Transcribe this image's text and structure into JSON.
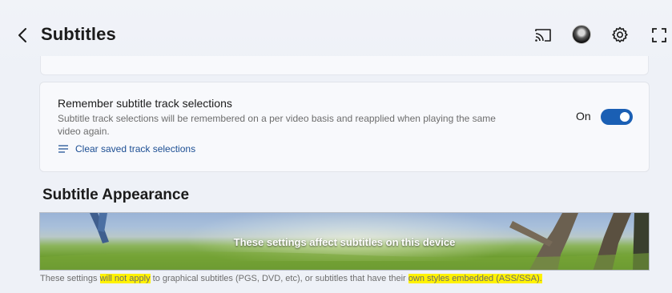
{
  "header": {
    "title": "Subtitles",
    "icons": [
      "back-arrow-icon",
      "cast-icon",
      "avatar",
      "gear-icon",
      "fullscreen-icon"
    ]
  },
  "remember_setting": {
    "title": "Remember subtitle track selections",
    "description": "Subtitle track selections will be remembered on a per video basis and reapplied when playing the same video again.",
    "clear_link": "Clear saved track selections",
    "state_label": "On",
    "enabled": true
  },
  "appearance": {
    "heading": "Subtitle Appearance",
    "banner_text": "These settings affect subtitles on this device",
    "note": {
      "part1": "These settings ",
      "highlight1": "will not apply",
      "part2": " to graphical subtitles (PGS, DVD, etc), or subtitles that have their ",
      "highlight2": "own styles embedded (ASS/SSA)."
    }
  },
  "colors": {
    "accent": "#1a5fb4",
    "link": "#1c4e93",
    "highlight": "#fff200",
    "background": "#eef1f7"
  }
}
